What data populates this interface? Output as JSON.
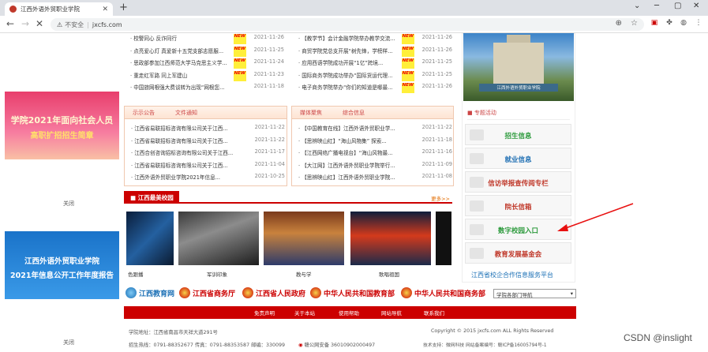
{
  "browser": {
    "tab_title": "江西外语外贸职业学院",
    "url_security": "不安全",
    "url": "jxcfs.com"
  },
  "left_ads": [
    {
      "line1": "学院2021年面向社会人员",
      "line2": "高职扩招招生简章",
      "close": "关闭"
    },
    {
      "line1": "江西外语外贸职业学院",
      "line2": "2021年信息公开工作年度报告",
      "close": "关闭"
    }
  ],
  "news_left": [
    {
      "t": "· 校警同心 反诈同行",
      "new": "NEW",
      "d": "2021-11-26"
    },
    {
      "t": "· 点亮爱心灯 真爱新十五党支部志愿服...",
      "new": "NEW",
      "d": "2021-11-25"
    },
    {
      "t": "· 思政部参加江西师范大学马克思主义学...",
      "new": "NEW",
      "d": "2021-11-24"
    },
    {
      "t": "· 重走红军路 同上军建山",
      "new": "NEW",
      "d": "2021-11-23"
    },
    {
      "t": "· 中国旅网根强大费谈转为出现“网根您...",
      "new": "",
      "d": "2021-11-18"
    }
  ],
  "news_right": [
    {
      "t": "· 【教学节】会计金融学院举办教学交流...",
      "new": "NEW",
      "d": "2021-11-26"
    },
    {
      "t": "· 商贸学院党总支开展“树先锋，学榜样...",
      "new": "NEW",
      "d": "2021-11-26"
    },
    {
      "t": "· 应用西语学院成功开展“1亿”跨境...",
      "new": "NEW",
      "d": "2021-11-25"
    },
    {
      "t": "· 国际商务学院成功举办“国际货运代理...",
      "new": "NEW",
      "d": "2021-11-25"
    },
    {
      "t": "· 电子商务学院举办“你们的知道是哪最...",
      "new": "NEW",
      "d": "2021-11-26"
    }
  ],
  "notice": {
    "tab1": "示示公告",
    "tab2": "文件通知",
    "items": [
      {
        "t": "· 江西省易联招标咨询有限公司关于江西...",
        "d": "2021-11-22"
      },
      {
        "t": "· 江西省易联招标咨询有限公司关于江西...",
        "d": "2021-11-22"
      },
      {
        "t": "· 江西合创咨询招标咨询有限公司关于江西...",
        "d": "2021-11-17"
      },
      {
        "t": "· 江西省易联招标咨询有限公司关于江西...",
        "d": "2021-11-04"
      },
      {
        "t": "· 江西外语外贸职业学院2021年信息...",
        "d": "2021-10-25"
      }
    ]
  },
  "media": {
    "tab1": "媒体聚焦",
    "tab2": "综合信息",
    "items": [
      {
        "t": "· 【中国教育在线】江西外语外贸职业学...",
        "d": "2021-11-22"
      },
      {
        "t": "· 【思辨映山红】“海山风物集” 探索...",
        "d": "2021-11-18"
      },
      {
        "t": "· 【江西网络广播电视台】“海山风物最...",
        "d": "2021-11-16"
      },
      {
        "t": "· 【大江网】江西外语外贸职业学院举行...",
        "d": "2021-11-09"
      },
      {
        "t": "· 【思辨映山红】江西外语外贸职业学院...",
        "d": "2021-11-08"
      }
    ]
  },
  "campus": {
    "title": "江西最美校园",
    "more": "更多>>",
    "captions": [
      "色跟播",
      "军训印象",
      "教与学",
      "歌唱祖国"
    ]
  },
  "sidebar": {
    "campus_sign": "江西外语外贸职业学院",
    "topic": "专题活动",
    "buttons": [
      {
        "label": "招生信息",
        "color": "#2c9a3c"
      },
      {
        "label": "就业信息",
        "color": "#1f6fb3"
      },
      {
        "label": "信访举报查传阅专栏",
        "color": "#c0392b"
      },
      {
        "label": "院长信箱",
        "color": "#c0392b"
      },
      {
        "label": "数字校园入口",
        "color": "#2c9a3c"
      },
      {
        "label": "教育发展基金会",
        "color": "#c0392b"
      }
    ],
    "gov": "江西省校企合作信息服务平台"
  },
  "logos": [
    "江西教育网",
    "江西省商务厅",
    "江西省人民政府",
    "中华人民共和国教育部",
    "中华人民共和国商务部"
  ],
  "select": "学院各部门导航",
  "links": [
    "免责声明",
    "关于本站",
    "使用帮助",
    "网站导航",
    "联系我们"
  ],
  "footer": {
    "addr": "学院地址：江西省南昌市天祥大道291号",
    "copyright": "Copyright © 2015 jxcfs.com ALL Rights Reserved",
    "phone": "招生热线：0791-88352677 传真：0791-88353587 邮编：330099",
    "police": "赣公网安备 36010902000497",
    "tech": "技术支持：微网科技 网站备案编号：赣ICP备16005794号-1"
  },
  "watermark": "CSDN @inslight"
}
